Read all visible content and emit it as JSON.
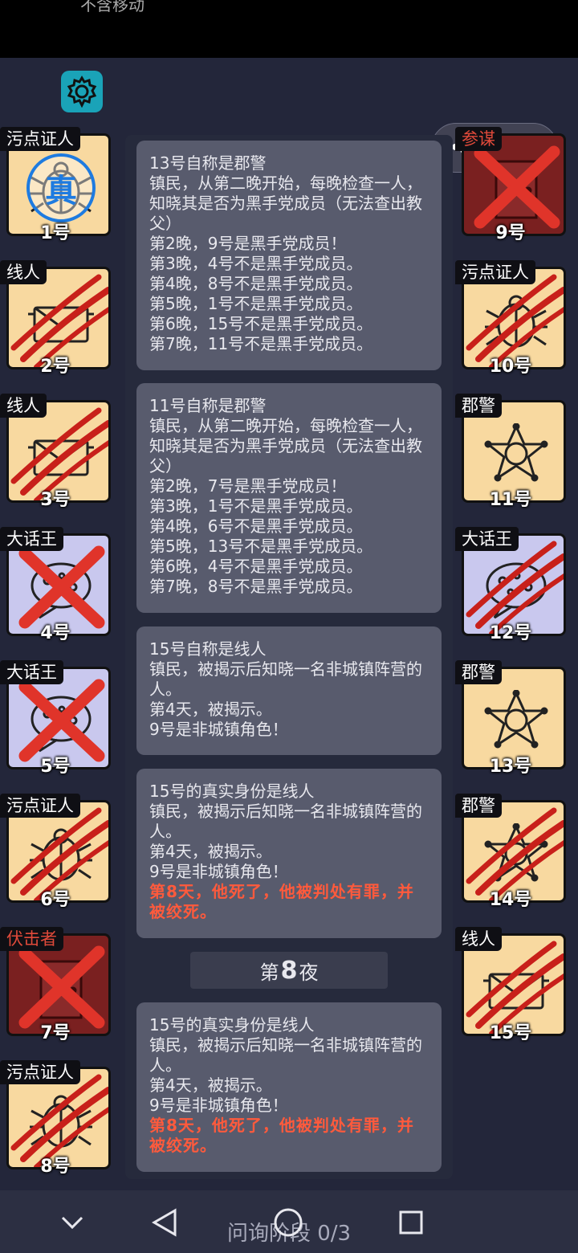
{
  "status_bar": {
    "text": "不含移动"
  },
  "top_icons": {
    "settings": "gear-icon",
    "menu": "more-dots-icon",
    "close": "target-icon"
  },
  "players_left": [
    {
      "num": "1号",
      "role": "污点证人",
      "style": "tan",
      "emblem": "beetle",
      "mark": "verified",
      "badge": "真"
    },
    {
      "num": "2号",
      "role": "线人",
      "style": "tan",
      "emblem": "envelope",
      "mark": "claw"
    },
    {
      "num": "3号",
      "role": "线人",
      "style": "tan",
      "emblem": "envelope",
      "mark": "claw"
    },
    {
      "num": "4号",
      "role": "大话王",
      "style": "blue",
      "emblem": "bubble",
      "mark": "cross"
    },
    {
      "num": "5号",
      "role": "大话王",
      "style": "blue",
      "emblem": "bubble",
      "mark": "cross"
    },
    {
      "num": "6号",
      "role": "污点证人",
      "style": "tan",
      "emblem": "beetle",
      "mark": "claw"
    },
    {
      "num": "7号",
      "role": "伏击者",
      "style": "red",
      "emblem": "door",
      "mark": "cross"
    },
    {
      "num": "8号",
      "role": "污点证人",
      "style": "tan",
      "emblem": "beetle",
      "mark": "claw"
    }
  ],
  "players_right": [
    {
      "num": "9号",
      "role": "参谋",
      "style": "red",
      "emblem": "door",
      "mark": "cross"
    },
    {
      "num": "10号",
      "role": "污点证人",
      "style": "tan",
      "emblem": "beetle",
      "mark": "claw"
    },
    {
      "num": "11号",
      "role": "郡警",
      "style": "tan",
      "emblem": "star",
      "mark": "none"
    },
    {
      "num": "12号",
      "role": "大话王",
      "style": "blue",
      "emblem": "bubble",
      "mark": "claw"
    },
    {
      "num": "13号",
      "role": "郡警",
      "style": "tan",
      "emblem": "star",
      "mark": "none"
    },
    {
      "num": "14号",
      "role": "郡警",
      "style": "tan",
      "emblem": "star",
      "mark": "claw"
    },
    {
      "num": "15号",
      "role": "线人",
      "style": "tan",
      "emblem": "envelope",
      "mark": "claw"
    }
  ],
  "messages": [
    {
      "lines": [
        "13号自称是郡警",
        "镇民，从第二晚开始，每晚检查一人，知晓其是否为黑手党成员（无法查出教父）",
        "第2晚，9号是黑手党成员！",
        "第3晚，4号不是黑手党成员。",
        "第4晚，8号不是黑手党成员。",
        "第5晚，1号不是黑手党成员。",
        "第6晚，15号不是黑手党成员。",
        "第7晚，11号不是黑手党成员。"
      ],
      "alert": ""
    },
    {
      "lines": [
        "11号自称是郡警",
        "镇民，从第二晚开始，每晚检查一人，知晓其是否为黑手党成员（无法查出教父）",
        "第2晚，7号是黑手党成员！",
        "第3晚，1号不是黑手党成员。",
        "第4晚，6号不是黑手党成员。",
        "第5晚，13号不是黑手党成员。",
        "第6晚，4号不是黑手党成员。",
        "第7晚，8号不是黑手党成员。"
      ],
      "alert": ""
    },
    {
      "lines": [
        "15号自称是线人",
        "镇民，被揭示后知晓一名非城镇阵营的人。",
        "第4天，被揭示。",
        "9号是非城镇角色！"
      ],
      "alert": ""
    },
    {
      "lines": [
        "15号的真实身份是线人",
        "镇民，被揭示后知晓一名非城镇阵营的人。",
        "第4天，被揭示。",
        "9号是非城镇角色！"
      ],
      "alert": "第8天，他死了，他被判处有罪，并被绞死。"
    },
    {
      "lines": [
        "15号的真实身份是线人",
        "镇民，被揭示后知晓一名非城镇阵营的人。",
        "第4天，被揭示。",
        "9号是非城镇角色！"
      ],
      "alert": "第8天，他死了，他被判处有罪，并被绞死。"
    }
  ],
  "night_label": {
    "prefix": "第",
    "number": "8",
    "suffix": "夜"
  },
  "bottom": {
    "phase": "问询阶段 0/3"
  },
  "nav_icons": [
    "chevron-down-icon",
    "back-icon",
    "home-icon",
    "recent-apps-icon"
  ]
}
